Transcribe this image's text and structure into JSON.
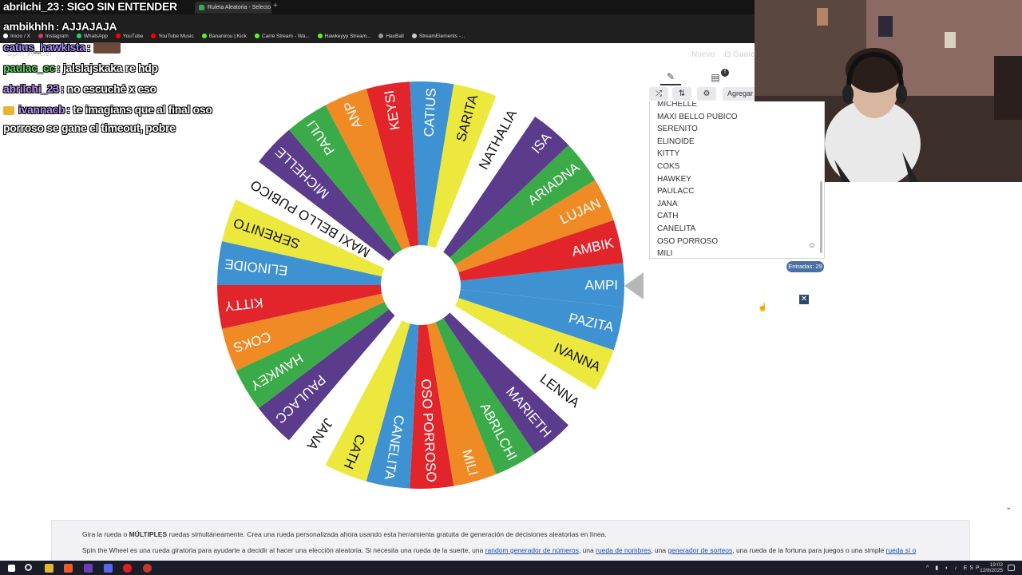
{
  "browser": {
    "active_tab_title": "Ruleta Aleatoria - Selecto",
    "new_tab_label": "+",
    "bookmarks": [
      {
        "label": "Inicio / X",
        "color": "#ffffff"
      },
      {
        "label": "Instagram",
        "color": "#e1306c"
      },
      {
        "label": "WhatsApp",
        "color": "#25d366"
      },
      {
        "label": "YouTube",
        "color": "#ff0000"
      },
      {
        "label": "YouTube Music",
        "color": "#ff0000"
      },
      {
        "label": "Bananirou | Kick",
        "color": "#53fc18"
      },
      {
        "label": "Carre Stream - Wa...",
        "color": "#53fc18"
      },
      {
        "label": "Hawkeyyy Stream...",
        "color": "#53fc18"
      },
      {
        "label": "HaxBall",
        "color": "#999999"
      },
      {
        "label": "StreamElements -...",
        "color": "#cccccc"
      }
    ]
  },
  "chat": [
    {
      "user": "abrilchi_23",
      "user_color": "#ffffff",
      "message": ": SIGO SIN ENTENDER"
    },
    {
      "user": "ambikhhh",
      "user_color": "#ffffff",
      "message": ": AJJAJAJA"
    },
    {
      "user": "catius_hawkista",
      "user_color": "#a78bfa",
      "message": ":"
    },
    {
      "user": "paulac_cc",
      "user_color": "#5fd35f",
      "message": ": jalslajskaka re hdp"
    },
    {
      "user": "abrilchi_23",
      "user_color": "#b794f4",
      "message": ": no escuché x eso"
    },
    {
      "user": "ivannacb",
      "user_color": "#b794f4",
      "message": ": te imagians que al final oso"
    },
    {
      "user": "",
      "user_color": "#ffffff",
      "message": "porroso se gane el timeout, pobre"
    }
  ],
  "ghost_labels": {
    "title": "Spin Wheel",
    "new": "Nuevo",
    "save": "Guard"
  },
  "wheel": {
    "colors": [
      "#3f92d2",
      "#e2252b",
      "#f08a24",
      "#3aab48",
      "#5b3b8c",
      "#ffffff",
      "#ece83e"
    ],
    "segments": [
      "AMPI",
      "AMBIK",
      "LUJAN",
      "ARIADNA",
      "ISA",
      "NATHALIA",
      "SARITA",
      "CATIUS",
      "KEYSI",
      "ANP",
      "PAULI",
      "MICHELLE",
      "MAXI BELLO PUBICO",
      "SERENITO",
      "ELINOIDE",
      "KITTY",
      "COKS",
      "HAWKEY",
      "PAULACC",
      "JANA",
      "CATH",
      "CANELITA",
      "OSO PORROSO",
      "MILI",
      "ABRILCHI",
      "MARIETH",
      "LENNA",
      "IVANNA",
      "PAZITA"
    ]
  },
  "panel": {
    "add_label": "Agregar",
    "badge": "f",
    "entries_count_label": "Entradas: 29",
    "entries": [
      "MICHELLE",
      "MAXI BELLO PUBICO",
      "SERENITO",
      "ELINOIDE",
      "KITTY",
      "COKS",
      "HAWKEY",
      "PAULACC",
      "JANA",
      "CATH",
      "CANELITA",
      "OSO PORROSO",
      "MILI"
    ],
    "emoji_glyph": "☺",
    "close_glyph": "✕"
  },
  "info": {
    "p1_pre": "Gira la rueda o ",
    "p1_bold": "MÚLTIPLES",
    "p1_post": " ruedas simultáneamente. Crea una rueda personalizada ahora usando esta herramienta gratuita de generación de decisiones aleatorias en línea.",
    "p2_pre": "Spin the Wheel es una rueda giratoria para ayudarte a decidir al hacer una elección aleatoria. Si necesita una rueda de la suerte, una ",
    "p2_link1": "random generador de números",
    "p2_mid1": ", una ",
    "p2_link2": "rueda de nombres",
    "p2_mid2": ", una ",
    "p2_link3": "generador de sorteos",
    "p2_mid3": ", una rueda de la fortuna para juegos o una simple ",
    "p2_link4": "rueda sí o"
  },
  "taskbar": {
    "lang": "ESP",
    "time": "19:02",
    "date": "12/8/2025"
  }
}
